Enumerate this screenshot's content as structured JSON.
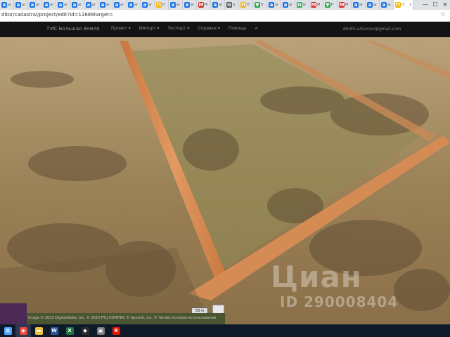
{
  "browser": {
    "tabs": [
      {
        "favicon": "a",
        "color": "#1a73e8",
        "title": "ar"
      },
      {
        "favicon": "a",
        "color": "#1a73e8",
        "title": "ar"
      },
      {
        "favicon": "a",
        "color": "#1a73e8",
        "title": "ar"
      },
      {
        "favicon": "a",
        "color": "#1a73e8",
        "title": "ar"
      },
      {
        "favicon": "a",
        "color": "#1a73e8",
        "title": "ar"
      },
      {
        "favicon": "a",
        "color": "#1a73e8",
        "title": "ar"
      },
      {
        "favicon": "a",
        "color": "#1a73e8",
        "title": "ar"
      },
      {
        "favicon": "a",
        "color": "#1a73e8",
        "title": "ar"
      },
      {
        "favicon": "a",
        "color": "#1a73e8",
        "title": "ar"
      },
      {
        "favicon": "a",
        "color": "#1a73e8",
        "title": "ar"
      },
      {
        "favicon": "a",
        "color": "#1a73e8",
        "title": "ar"
      },
      {
        "favicon": "П",
        "color": "#f2b300",
        "title": "П"
      },
      {
        "favicon": "a",
        "color": "#1a73e8",
        "title": "ar"
      },
      {
        "favicon": "a",
        "color": "#1a73e8",
        "title": "ar"
      },
      {
        "favicon": "M",
        "color": "#d93025",
        "title": "M"
      },
      {
        "favicon": "a",
        "color": "#1a73e8",
        "title": "ar"
      },
      {
        "favicon": "G",
        "color": "#555555",
        "title": "G"
      },
      {
        "favicon": "П",
        "color": "#f2b300",
        "title": "П"
      },
      {
        "favicon": "▼",
        "color": "#34a853",
        "title": "fr"
      },
      {
        "favicon": "a",
        "color": "#1a73e8",
        "title": "ar"
      },
      {
        "favicon": "a",
        "color": "#1a73e8",
        "title": "ar"
      },
      {
        "favicon": "G",
        "color": "#34a853",
        "title": "G"
      },
      {
        "favicon": "M",
        "color": "#d93025",
        "title": "M"
      },
      {
        "favicon": "▼",
        "color": "#34a853",
        "title": "fr"
      },
      {
        "favicon": "M",
        "color": "#d93025",
        "title": "M"
      },
      {
        "favicon": "a",
        "color": "#1a73e8",
        "title": "ar"
      },
      {
        "favicon": "a",
        "color": "#1a73e8",
        "title": "ar"
      },
      {
        "favicon": "a",
        "color": "#1a73e8",
        "title": "ar"
      },
      {
        "favicon": "П",
        "color": "#f2b300",
        "title": "П",
        "active": true
      }
    ],
    "url": "ditor/cadastral/project/edit?id=11689target=",
    "window_controls": [
      "—",
      "☐",
      "✕"
    ]
  },
  "app": {
    "brand": "ГИС Большая Земля",
    "menu": [
      "Проект ▾",
      "Импорт ▾",
      "Экспорт ▾",
      "Справка ▾",
      "Помощь",
      "✔"
    ],
    "user": "dmitri.artemov@gmail.com"
  },
  "map": {
    "watermark_logo": "Циан",
    "watermark_id": "ID 290008404",
    "scale_label": "50 м",
    "attribution": "Image © 2022 DigitalGlobe, Inc. © 2020 РТЦ КОМПИС © Sputnik, Inc. © Yandex Условия использования"
  },
  "taskbar": {
    "items": [
      {
        "icon": "windows-start-icon",
        "color": "#4aa3ff",
        "glyph": "⊞"
      },
      {
        "icon": "chrome-icon",
        "color": "#e8453c",
        "glyph": "◉",
        "active": true
      },
      {
        "icon": "file-explorer-icon",
        "color": "#f0c040",
        "glyph": "▬"
      },
      {
        "icon": "word-icon",
        "color": "#2b579a",
        "glyph": "W"
      },
      {
        "icon": "excel-icon",
        "color": "#217346",
        "glyph": "X"
      },
      {
        "icon": "app-icon",
        "color": "#2b2b2b",
        "glyph": "◆"
      },
      {
        "icon": "app-icon-2",
        "color": "#7a7a7a",
        "glyph": "▣"
      },
      {
        "icon": "yandex-icon",
        "color": "#e61400",
        "glyph": "Я"
      }
    ]
  }
}
